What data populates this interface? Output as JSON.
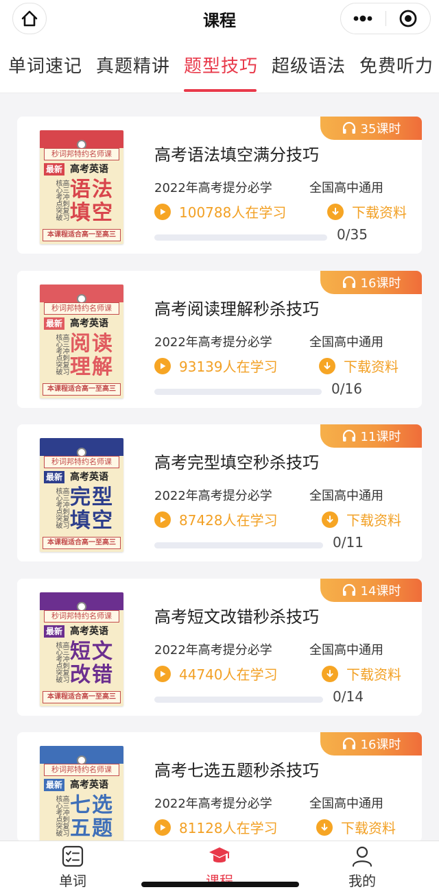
{
  "header": {
    "title": "课程"
  },
  "tabs": [
    {
      "label": "单词速记"
    },
    {
      "label": "真题精讲"
    },
    {
      "label": "题型技巧",
      "active": true
    },
    {
      "label": "超级语法"
    },
    {
      "label": "免费听力"
    }
  ],
  "cover_common": {
    "brand": "秒词邦特约名师课",
    "new_tag": "最新",
    "subject": "高考英语",
    "side_a": "核心考点突破",
    "side_b": "高三冲刺复习",
    "footer": "本课程适合高一至高三"
  },
  "courses": [
    {
      "lessons": "35课时",
      "title": "高考语法填空满分技巧",
      "subtitle": "2022年高考提分必学",
      "scope": "全国高中通用",
      "learners": "100788人在学习",
      "download": "下载资料",
      "progress_text": "0/35",
      "progress": 0,
      "cover_title": "语法填空",
      "cover_color": "#d8454c"
    },
    {
      "lessons": "16课时",
      "title": "高考阅读理解秒杀技巧",
      "subtitle": "2022年高考提分必学",
      "scope": "全国高中通用",
      "learners": "93139人在学习",
      "download": "下载资料",
      "progress_text": "0/16",
      "progress": 0,
      "cover_title": "阅读理解",
      "cover_color": "#e05a5f"
    },
    {
      "lessons": "11课时",
      "title": "高考完型填空秒杀技巧",
      "subtitle": "2022年高考提分必学",
      "scope": "全国高中通用",
      "learners": "87428人在学习",
      "download": "下载资料",
      "progress_text": "0/11",
      "progress": 0,
      "cover_title": "完型填空",
      "cover_color": "#2d3e8c"
    },
    {
      "lessons": "14课时",
      "title": "高考短文改错秒杀技巧",
      "subtitle": "2022年高考提分必学",
      "scope": "全国高中通用",
      "learners": "44740人在学习",
      "download": "下载资料",
      "progress_text": "0/14",
      "progress": 0,
      "cover_title": "短文改错",
      "cover_color": "#6b2f8f"
    },
    {
      "lessons": "16课时",
      "title": "高考七选五题秒杀技巧",
      "subtitle": "2022年高考提分必学",
      "scope": "全国高中通用",
      "learners": "81128人在学习",
      "download": "下载资料",
      "progress_text": "",
      "progress": 0,
      "cover_title": "七选五题",
      "cover_color": "#3f6fb8"
    }
  ],
  "bottom_nav": [
    {
      "label": "单词",
      "icon": "checklist-icon"
    },
    {
      "label": "课程",
      "icon": "graduation-cap-icon",
      "active": true
    },
    {
      "label": "我的",
      "icon": "user-icon"
    }
  ],
  "colors": {
    "accent": "#e8394a",
    "orange": "#f2a024",
    "badge": "#f39740"
  }
}
